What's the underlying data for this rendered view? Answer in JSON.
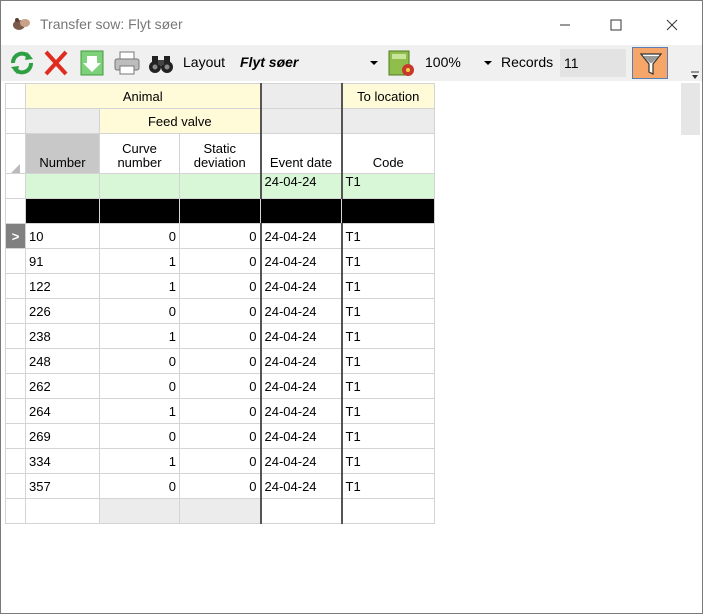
{
  "window": {
    "title": "Transfer sow: Flyt søer",
    "icon": "pigs-icon",
    "controls": [
      "minimize-icon",
      "maximize-icon",
      "close-icon"
    ]
  },
  "toolbar": {
    "icons": [
      "refresh-icon",
      "delete-icon",
      "save-icon",
      "print-icon",
      "binoculars-icon",
      "layout-settings-icon",
      "filter-icon"
    ],
    "layout_label": "Layout",
    "layout_value": "Flyt søer",
    "zoom_value": "100%",
    "records_label": "Records",
    "records_value": "11"
  },
  "grid": {
    "group_headers": {
      "animal": "Animal",
      "feed_valve": "Feed valve",
      "to_location": "To location"
    },
    "columns": {
      "number": "Number",
      "curve_number_1": "Curve",
      "curve_number_2": "number",
      "static_dev_1": "Static",
      "static_dev_2": "deviation",
      "event_date": "Event date",
      "code": "Code"
    },
    "sort_indicator": "∆",
    "filter_row": {
      "event_date": "24-04-24",
      "code": "T1"
    },
    "current_row_marker": ">",
    "rows": [
      {
        "number": "10",
        "curve": "0",
        "static": "0",
        "date": "24-04-24",
        "code": "T1"
      },
      {
        "number": "91",
        "curve": "1",
        "static": "0",
        "date": "24-04-24",
        "code": "T1"
      },
      {
        "number": "122",
        "curve": "1",
        "static": "0",
        "date": "24-04-24",
        "code": "T1"
      },
      {
        "number": "226",
        "curve": "0",
        "static": "0",
        "date": "24-04-24",
        "code": "T1"
      },
      {
        "number": "238",
        "curve": "1",
        "static": "0",
        "date": "24-04-24",
        "code": "T1"
      },
      {
        "number": "248",
        "curve": "0",
        "static": "0",
        "date": "24-04-24",
        "code": "T1"
      },
      {
        "number": "262",
        "curve": "0",
        "static": "0",
        "date": "24-04-24",
        "code": "T1"
      },
      {
        "number": "264",
        "curve": "1",
        "static": "0",
        "date": "24-04-24",
        "code": "T1"
      },
      {
        "number": "269",
        "curve": "0",
        "static": "0",
        "date": "24-04-24",
        "code": "T1"
      },
      {
        "number": "334",
        "curve": "1",
        "static": "0",
        "date": "24-04-24",
        "code": "T1"
      },
      {
        "number": "357",
        "curve": "0",
        "static": "0",
        "date": "24-04-24",
        "code": "T1"
      }
    ]
  },
  "colors": {
    "group_header_bg": "#fffbd8",
    "filter_row_bg": "#d7f7d7",
    "filter_button_bg": "#f7a66a"
  }
}
